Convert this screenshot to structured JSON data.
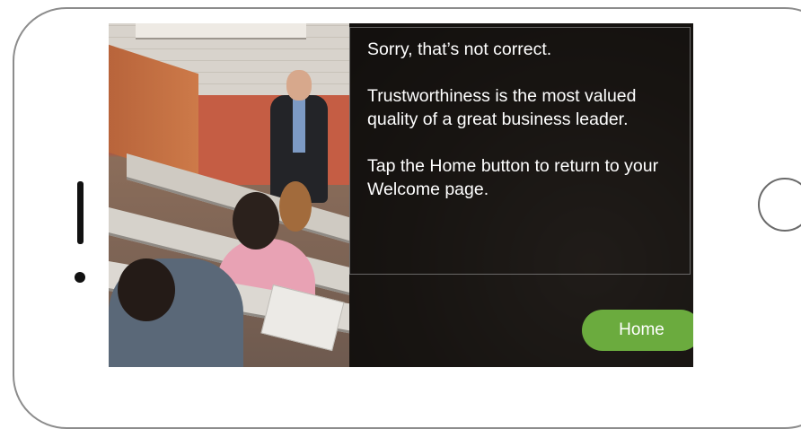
{
  "feedback": {
    "heading": "Sorry, that’s not correct.",
    "explanation": "Trustworthiness is the most valued quality of a great business leader.",
    "instruction": "Tap the Home button to return to your Welcome page."
  },
  "buttons": {
    "home_label": "Home"
  },
  "colors": {
    "home_button": "#6bab3e",
    "overlay": "#0a0807",
    "text": "#ffffff"
  },
  "icons": {
    "speaker": "speaker-slot-icon",
    "camera": "camera-dot-icon",
    "home_hardware": "hardware-home-button-icon"
  }
}
